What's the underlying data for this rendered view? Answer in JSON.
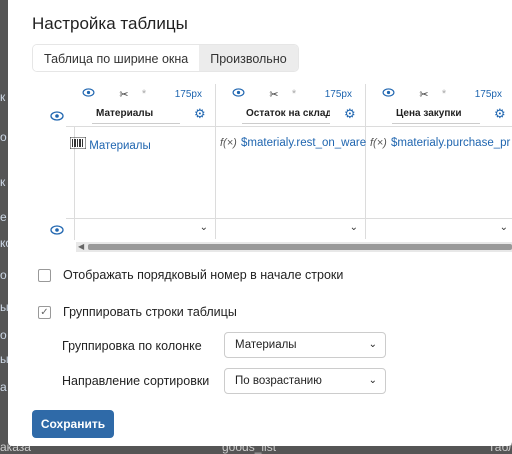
{
  "background": {
    "left_fragments": [
      "к",
      "о",
      "к",
      "е",
      "ко",
      "о",
      "ы",
      "о",
      "ы",
      "а"
    ],
    "bottom_left": "аказа",
    "bottom_mid": "goods_list",
    "bottom_right": "Табл"
  },
  "dialog": {
    "title": "Настройка таблицы",
    "width_tabs": [
      {
        "label": "Таблица по ширине окна",
        "active": true
      },
      {
        "label": "Произвольно",
        "active": false
      }
    ],
    "columns": [
      {
        "width_label": "175px",
        "field": "Материалы",
        "content": "Материалы",
        "content_kind": "barcode"
      },
      {
        "width_label": "175px",
        "field": "Остаток на склад",
        "content": "$materialy.rest_on_ware",
        "content_kind": "formula"
      },
      {
        "width_label": "175px",
        "field": "Цена закупки",
        "content": "$materialy.purchase_pr",
        "content_kind": "formula"
      }
    ],
    "formula_prefix": "f(×)",
    "show_row_number": {
      "label": "Отображать порядковый номер в начале строки",
      "checked": false
    },
    "group_rows": {
      "label": "Группировать строки таблицы",
      "checked": true
    },
    "group_by": {
      "label": "Группировка по колонке",
      "value": "Материалы"
    },
    "sort_dir": {
      "label": "Направление сортировки",
      "value": "По возрастанию"
    },
    "save_label": "Сохранить",
    "accent": "#2f6aa8"
  }
}
